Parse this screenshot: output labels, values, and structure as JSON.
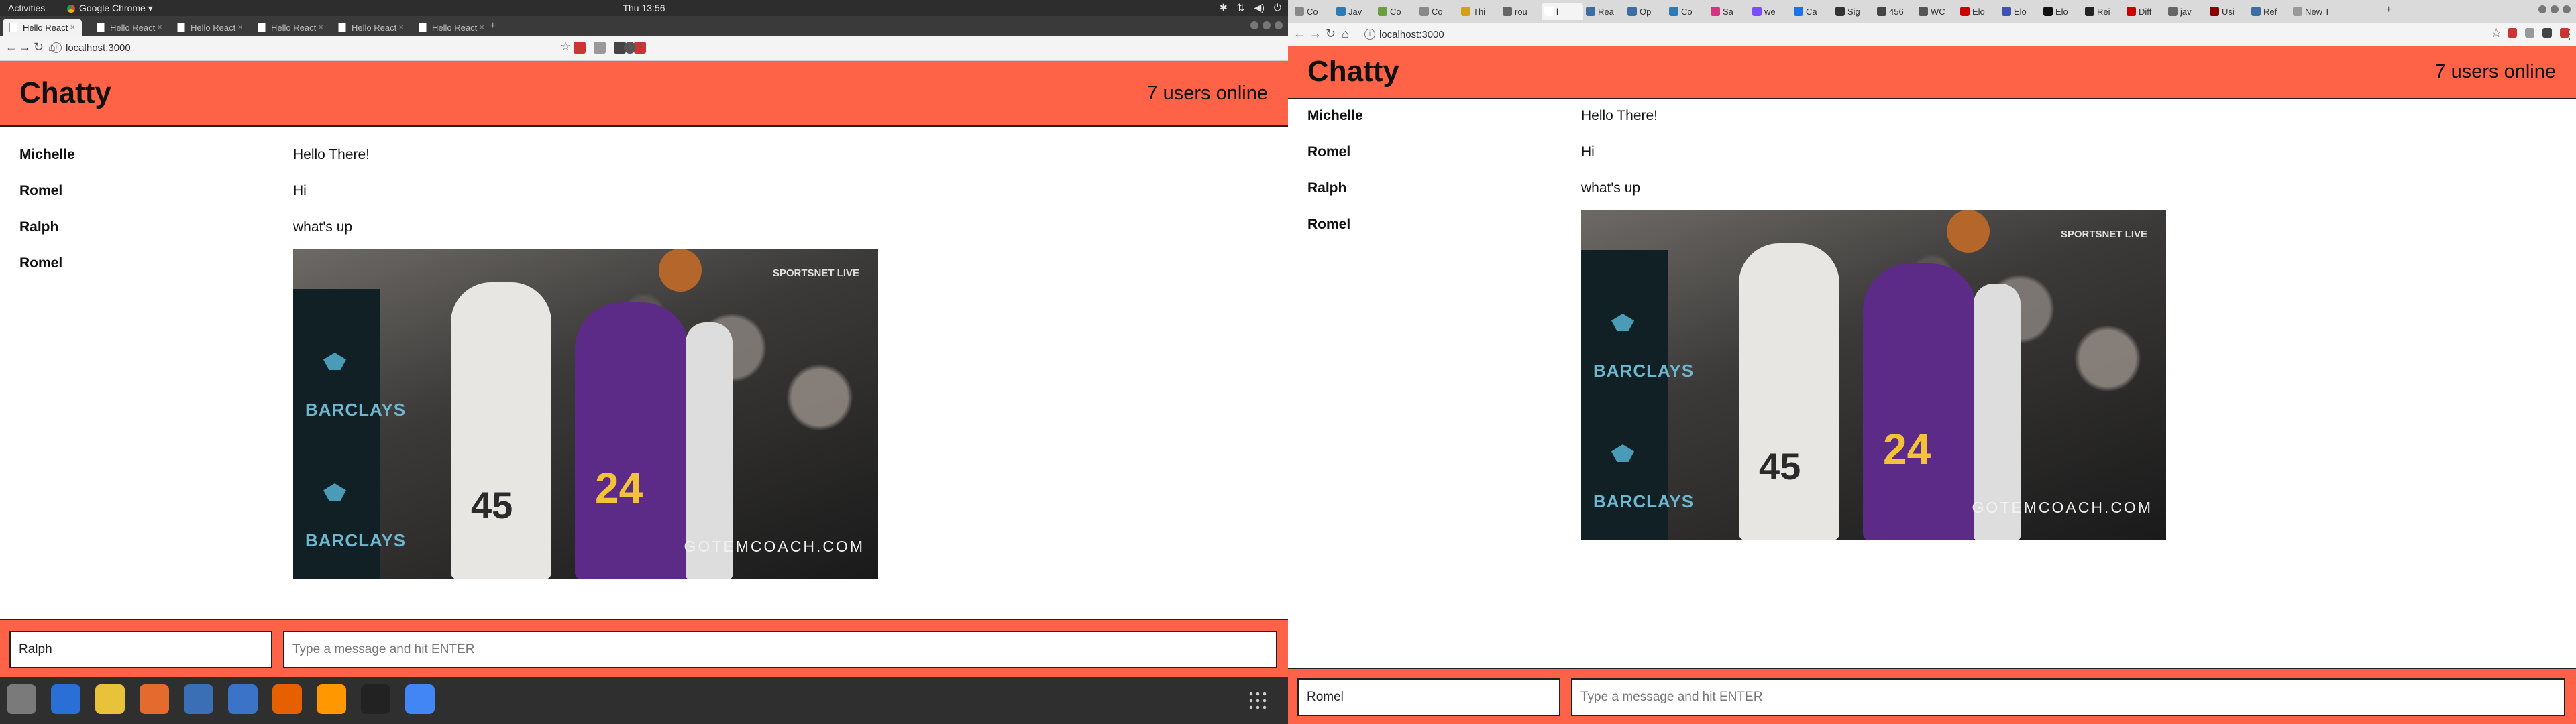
{
  "gnome_bar": {
    "activities": "Activities",
    "app_menu": "Google Chrome ▾",
    "clock": "Thu 13:56"
  },
  "left_browser": {
    "tabs": [
      {
        "label": "Hello React",
        "active": true
      },
      {
        "label": "Hello React",
        "active": false
      },
      {
        "label": "Hello React",
        "active": false
      },
      {
        "label": "Hello React",
        "active": false
      },
      {
        "label": "Hello React",
        "active": false
      },
      {
        "label": "Hello React",
        "active": false
      }
    ],
    "url": "localhost:3000"
  },
  "right_browser": {
    "tabs": [
      "Co",
      "Jav",
      "Co",
      "Co",
      "Thi",
      "rou",
      "l",
      "Rea",
      "Op",
      "Co",
      "Sa",
      "we",
      "Ca",
      "Sig",
      "456",
      "WC",
      "Elo",
      "Elo",
      "Elo",
      "Rei",
      "Diff",
      "jav",
      "Usi",
      "Ref",
      "New T"
    ],
    "url": "localhost:3000"
  },
  "app": {
    "brand": "Chatty",
    "users_online": "7 users online",
    "messages": [
      {
        "user": "Michelle",
        "content": "Hello There!"
      },
      {
        "user": "Romel",
        "content": "Hi"
      },
      {
        "user": "Ralph",
        "content": "what's up"
      },
      {
        "user": "Romel",
        "content": "[gif]"
      }
    ],
    "gif": {
      "jersey_1": "45",
      "jersey_2": "24",
      "sponsor": "BARCLAYS",
      "broadcaster": "SPORTSNET LIVE",
      "watermark": "GOTEMCOACH.COM"
    },
    "message_placeholder": "Type a message and hit ENTER"
  },
  "left_chatbar": {
    "username": "Ralph"
  },
  "right_chatbar": {
    "username": "Romel"
  },
  "colors": {
    "accent": "#ff6347",
    "dock": "#2f2f2f"
  }
}
